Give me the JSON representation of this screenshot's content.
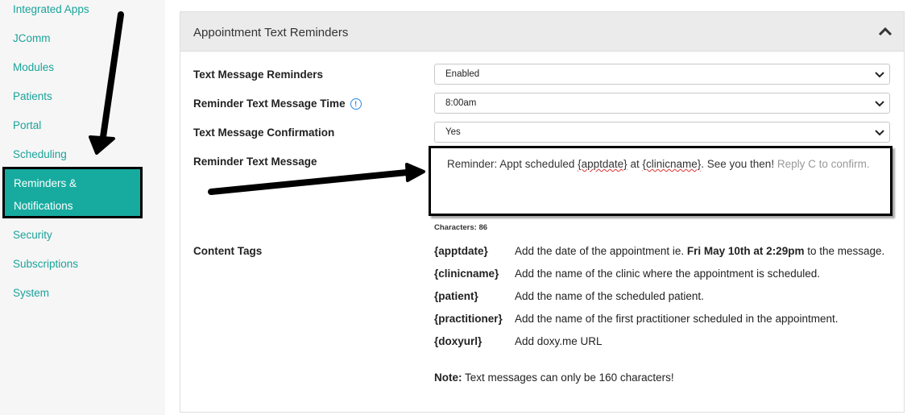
{
  "sidebar": {
    "items": [
      {
        "label": "Integrated Apps"
      },
      {
        "label": "JComm"
      },
      {
        "label": "Modules"
      },
      {
        "label": "Patients"
      },
      {
        "label": "Portal"
      },
      {
        "label": "Scheduling"
      },
      {
        "label_line1": "Reminders &",
        "label_line2": "Notifications",
        "active": true
      },
      {
        "label": "Security"
      },
      {
        "label": "Subscriptions"
      },
      {
        "label": "System"
      }
    ]
  },
  "panel": {
    "title": "Appointment Text Reminders",
    "fields": {
      "reminders_label": "Text Message Reminders",
      "reminders_value": "Enabled",
      "time_label": "Reminder Text Message Time",
      "time_value": "8:00am",
      "confirmation_label": "Text Message Confirmation",
      "confirmation_value": "Yes",
      "message_label": "Reminder Text Message",
      "message_part1": "Reminder: Appt scheduled ",
      "message_tag1": "{apptdate}",
      "message_part2": " at ",
      "message_tag2": "{clinicname}",
      "message_part3": ". See you then! ",
      "message_placeholder": "Reply C to confirm.",
      "characters": "Characters: 86"
    },
    "content_tags": {
      "label": "Content Tags",
      "tags": [
        {
          "name": "{apptdate}",
          "desc_pre": "Add the date of the appointment ie. ",
          "desc_bold": "Fri May 10th at 2:29pm",
          "desc_post": " to the message."
        },
        {
          "name": "{clinicname}",
          "desc": "Add the name of the clinic where the appointment is scheduled."
        },
        {
          "name": "{patient}",
          "desc": "Add the name of the scheduled patient."
        },
        {
          "name": "{practitioner}",
          "desc": "Add the name of the first practitioner scheduled in the appointment."
        },
        {
          "name": "{doxyurl}",
          "desc": "Add doxy.me URL"
        }
      ]
    },
    "note_bold": "Note:",
    "note_text": " Text messages can only be 160 characters!"
  },
  "colors": {
    "accent": "#17aba0",
    "link": "#1aa39a",
    "header_bg": "#ebebeb",
    "info": "#2b87e3"
  },
  "icons": [
    "chevron-up-icon",
    "chevron-down-icon",
    "info-icon"
  ]
}
